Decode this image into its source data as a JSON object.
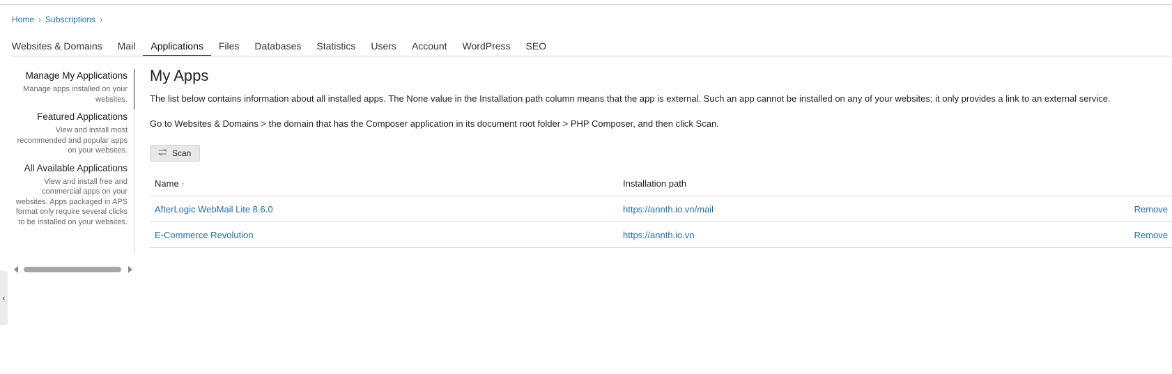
{
  "breadcrumb": {
    "home": "Home",
    "subscriptions": "Subscriptions",
    "separator": "›"
  },
  "tabs": [
    {
      "label": "Websites & Domains"
    },
    {
      "label": "Mail"
    },
    {
      "label": "Applications",
      "active": true
    },
    {
      "label": "Files"
    },
    {
      "label": "Databases"
    },
    {
      "label": "Statistics"
    },
    {
      "label": "Users"
    },
    {
      "label": "Account"
    },
    {
      "label": "WordPress"
    },
    {
      "label": "SEO"
    }
  ],
  "sidebar": {
    "items": [
      {
        "title": "Manage My Applications",
        "desc": "Manage apps installed on your websites."
      },
      {
        "title": "Featured Applications",
        "desc": "View and install most recommended and popular apps on your websites."
      },
      {
        "title": "All Available Applications",
        "desc": "View and install free and commercial apps on your websites. Apps packaged in APS format only require several clicks to be installed on your websites."
      }
    ]
  },
  "main": {
    "title": "My Apps",
    "para1": "The list below contains information about all installed apps. The None value in the Installation path column means that the app is external. Such an app cannot be installed on any of your websites; it only provides a link to an external service.",
    "para2": "Go to Websites & Domains > the domain that has the Composer application in its document root folder > PHP Composer, and then click Scan.",
    "scan_label": "Scan"
  },
  "table": {
    "headers": {
      "name": "Name",
      "sort_indicator": "↑",
      "path": "Installation path"
    },
    "rows": [
      {
        "name": "AfterLogic WebMail Lite 8.6.0",
        "path": "https://annth.io.vn/mail",
        "action": "Remove"
      },
      {
        "name": "E-Commerce Revolution",
        "path": "https://annth.io.vn",
        "action": "Remove"
      }
    ]
  },
  "collapse_glyph": "‹",
  "icons": {
    "scan": "scan-icon",
    "scroll_left": "scroll-left-icon",
    "scroll_right": "scroll-right-icon"
  },
  "colors": {
    "link": "#1f6fa8",
    "text": "#222222"
  }
}
